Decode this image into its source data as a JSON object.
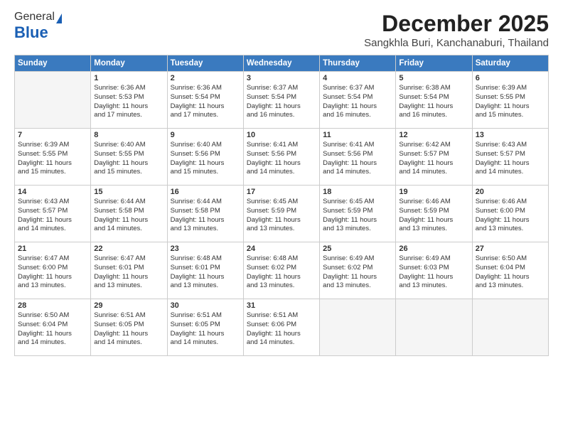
{
  "header": {
    "logo_general": "General",
    "logo_blue": "Blue",
    "month_title": "December 2025",
    "location": "Sangkhla Buri, Kanchanaburi, Thailand"
  },
  "weekdays": [
    "Sunday",
    "Monday",
    "Tuesday",
    "Wednesday",
    "Thursday",
    "Friday",
    "Saturday"
  ],
  "weeks": [
    [
      {
        "day": "",
        "empty": true
      },
      {
        "day": "1",
        "sunrise": "Sunrise: 6:36 AM",
        "sunset": "Sunset: 5:53 PM",
        "daylight": "Daylight: 11 hours and 17 minutes."
      },
      {
        "day": "2",
        "sunrise": "Sunrise: 6:36 AM",
        "sunset": "Sunset: 5:54 PM",
        "daylight": "Daylight: 11 hours and 17 minutes."
      },
      {
        "day": "3",
        "sunrise": "Sunrise: 6:37 AM",
        "sunset": "Sunset: 5:54 PM",
        "daylight": "Daylight: 11 hours and 16 minutes."
      },
      {
        "day": "4",
        "sunrise": "Sunrise: 6:37 AM",
        "sunset": "Sunset: 5:54 PM",
        "daylight": "Daylight: 11 hours and 16 minutes."
      },
      {
        "day": "5",
        "sunrise": "Sunrise: 6:38 AM",
        "sunset": "Sunset: 5:54 PM",
        "daylight": "Daylight: 11 hours and 16 minutes."
      },
      {
        "day": "6",
        "sunrise": "Sunrise: 6:39 AM",
        "sunset": "Sunset: 5:55 PM",
        "daylight": "Daylight: 11 hours and 15 minutes."
      }
    ],
    [
      {
        "day": "7",
        "sunrise": "Sunrise: 6:39 AM",
        "sunset": "Sunset: 5:55 PM",
        "daylight": "Daylight: 11 hours and 15 minutes."
      },
      {
        "day": "8",
        "sunrise": "Sunrise: 6:40 AM",
        "sunset": "Sunset: 5:55 PM",
        "daylight": "Daylight: 11 hours and 15 minutes."
      },
      {
        "day": "9",
        "sunrise": "Sunrise: 6:40 AM",
        "sunset": "Sunset: 5:56 PM",
        "daylight": "Daylight: 11 hours and 15 minutes."
      },
      {
        "day": "10",
        "sunrise": "Sunrise: 6:41 AM",
        "sunset": "Sunset: 5:56 PM",
        "daylight": "Daylight: 11 hours and 14 minutes."
      },
      {
        "day": "11",
        "sunrise": "Sunrise: 6:41 AM",
        "sunset": "Sunset: 5:56 PM",
        "daylight": "Daylight: 11 hours and 14 minutes."
      },
      {
        "day": "12",
        "sunrise": "Sunrise: 6:42 AM",
        "sunset": "Sunset: 5:57 PM",
        "daylight": "Daylight: 11 hours and 14 minutes."
      },
      {
        "day": "13",
        "sunrise": "Sunrise: 6:43 AM",
        "sunset": "Sunset: 5:57 PM",
        "daylight": "Daylight: 11 hours and 14 minutes."
      }
    ],
    [
      {
        "day": "14",
        "sunrise": "Sunrise: 6:43 AM",
        "sunset": "Sunset: 5:57 PM",
        "daylight": "Daylight: 11 hours and 14 minutes."
      },
      {
        "day": "15",
        "sunrise": "Sunrise: 6:44 AM",
        "sunset": "Sunset: 5:58 PM",
        "daylight": "Daylight: 11 hours and 14 minutes."
      },
      {
        "day": "16",
        "sunrise": "Sunrise: 6:44 AM",
        "sunset": "Sunset: 5:58 PM",
        "daylight": "Daylight: 11 hours and 13 minutes."
      },
      {
        "day": "17",
        "sunrise": "Sunrise: 6:45 AM",
        "sunset": "Sunset: 5:59 PM",
        "daylight": "Daylight: 11 hours and 13 minutes."
      },
      {
        "day": "18",
        "sunrise": "Sunrise: 6:45 AM",
        "sunset": "Sunset: 5:59 PM",
        "daylight": "Daylight: 11 hours and 13 minutes."
      },
      {
        "day": "19",
        "sunrise": "Sunrise: 6:46 AM",
        "sunset": "Sunset: 5:59 PM",
        "daylight": "Daylight: 11 hours and 13 minutes."
      },
      {
        "day": "20",
        "sunrise": "Sunrise: 6:46 AM",
        "sunset": "Sunset: 6:00 PM",
        "daylight": "Daylight: 11 hours and 13 minutes."
      }
    ],
    [
      {
        "day": "21",
        "sunrise": "Sunrise: 6:47 AM",
        "sunset": "Sunset: 6:00 PM",
        "daylight": "Daylight: 11 hours and 13 minutes."
      },
      {
        "day": "22",
        "sunrise": "Sunrise: 6:47 AM",
        "sunset": "Sunset: 6:01 PM",
        "daylight": "Daylight: 11 hours and 13 minutes."
      },
      {
        "day": "23",
        "sunrise": "Sunrise: 6:48 AM",
        "sunset": "Sunset: 6:01 PM",
        "daylight": "Daylight: 11 hours and 13 minutes."
      },
      {
        "day": "24",
        "sunrise": "Sunrise: 6:48 AM",
        "sunset": "Sunset: 6:02 PM",
        "daylight": "Daylight: 11 hours and 13 minutes."
      },
      {
        "day": "25",
        "sunrise": "Sunrise: 6:49 AM",
        "sunset": "Sunset: 6:02 PM",
        "daylight": "Daylight: 11 hours and 13 minutes."
      },
      {
        "day": "26",
        "sunrise": "Sunrise: 6:49 AM",
        "sunset": "Sunset: 6:03 PM",
        "daylight": "Daylight: 11 hours and 13 minutes."
      },
      {
        "day": "27",
        "sunrise": "Sunrise: 6:50 AM",
        "sunset": "Sunset: 6:04 PM",
        "daylight": "Daylight: 11 hours and 13 minutes."
      }
    ],
    [
      {
        "day": "28",
        "sunrise": "Sunrise: 6:50 AM",
        "sunset": "Sunset: 6:04 PM",
        "daylight": "Daylight: 11 hours and 14 minutes."
      },
      {
        "day": "29",
        "sunrise": "Sunrise: 6:51 AM",
        "sunset": "Sunset: 6:05 PM",
        "daylight": "Daylight: 11 hours and 14 minutes."
      },
      {
        "day": "30",
        "sunrise": "Sunrise: 6:51 AM",
        "sunset": "Sunset: 6:05 PM",
        "daylight": "Daylight: 11 hours and 14 minutes."
      },
      {
        "day": "31",
        "sunrise": "Sunrise: 6:51 AM",
        "sunset": "Sunset: 6:06 PM",
        "daylight": "Daylight: 11 hours and 14 minutes."
      },
      {
        "day": "",
        "empty": true
      },
      {
        "day": "",
        "empty": true
      },
      {
        "day": "",
        "empty": true
      }
    ]
  ]
}
